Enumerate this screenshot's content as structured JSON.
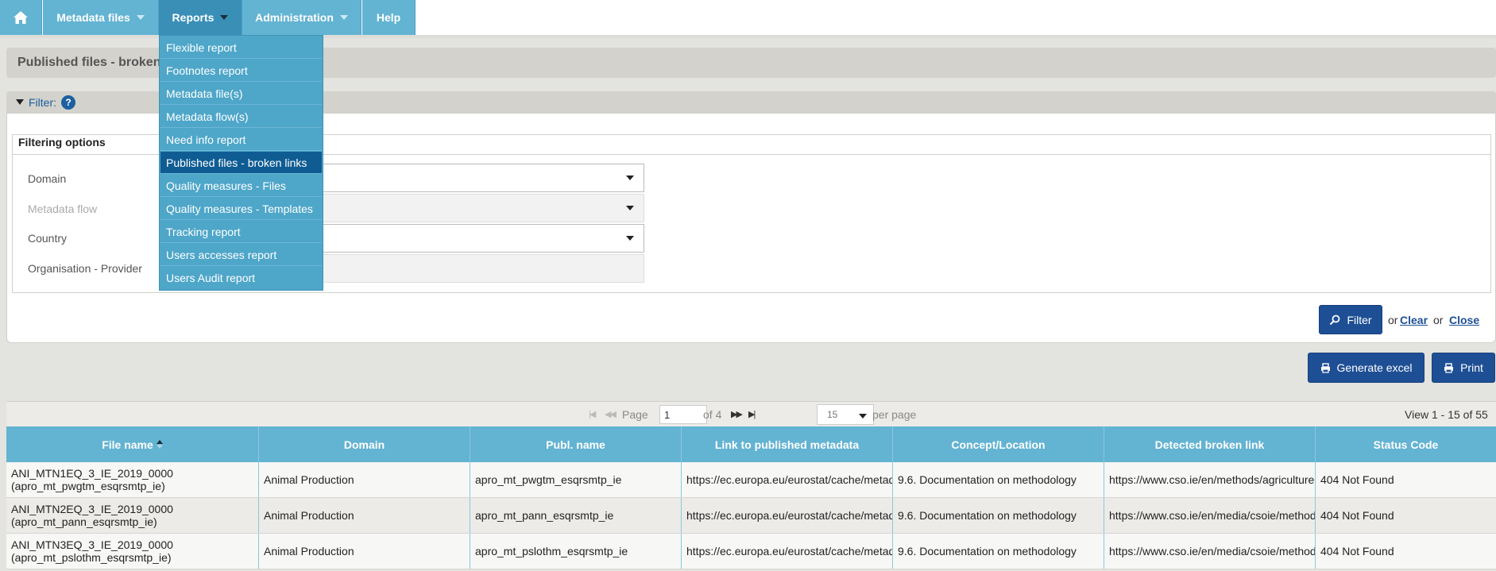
{
  "nav": {
    "items": [
      {
        "label": "Metadata files",
        "has_caret": true
      },
      {
        "label": "Reports",
        "has_caret": true,
        "active": true
      },
      {
        "label": "Administration",
        "has_caret": true
      },
      {
        "label": "Help",
        "has_caret": false
      }
    ]
  },
  "reports_menu": {
    "items": [
      "Flexible report",
      "Footnotes report",
      "Metadata file(s)",
      "Metadata flow(s)",
      "Need info report",
      "Published files - broken links",
      "Quality measures - Files",
      "Quality measures - Templates",
      "Tracking report",
      "Users accesses report",
      "Users Audit report"
    ],
    "active_item": "Published files - broken links"
  },
  "page": {
    "title": "Published files - broken links"
  },
  "filter": {
    "toggle_label": "Filter:",
    "help_label": "?",
    "legend": "Filtering options",
    "fields": [
      {
        "label": "Domain",
        "value": "",
        "disabled": false
      },
      {
        "label": "Metadata flow",
        "value": "",
        "disabled": true
      },
      {
        "label": "Country",
        "value": "",
        "disabled": false
      },
      {
        "label": "Organisation - Provider",
        "value": "",
        "disabled": true
      }
    ],
    "filter_button": "Filter",
    "or1": "or",
    "clear_link": "Clear",
    "or2": "or",
    "close_link": "Close"
  },
  "actions": {
    "generate_excel": "Generate excel",
    "print": "Print"
  },
  "pager": {
    "page_label": "Page",
    "page_value": "1",
    "of_label": "of 4",
    "per_page_value": "15",
    "per_page_label": "per page",
    "view_text": "View 1 - 15 of 55"
  },
  "table": {
    "columns": [
      "File name",
      "Domain",
      "Publ. name",
      "Link to published metadata",
      "Concept/Location",
      "Detected broken link",
      "Status Code"
    ],
    "sorted_column": "File name",
    "rows": [
      [
        "ANI_MTN1EQ_3_IE_2019_0000 (apro_mt_pwgtm_esqrsmtp_ie)",
        "Animal Production",
        "apro_mt_pwgtm_esqrsmtp_ie",
        "https://ec.europa.eu/eurostat/cache/metadata",
        "9.6. Documentation on methodology",
        "https://www.cso.ie/en/methods/agriculture",
        "404 Not Found"
      ],
      [
        "ANI_MTN2EQ_3_IE_2019_0000 (apro_mt_pann_esqrsmtp_ie)",
        "Animal Production",
        "apro_mt_pann_esqrsmtp_ie",
        "https://ec.europa.eu/eurostat/cache/metadata",
        "9.6. Documentation on methodology",
        "https://www.cso.ie/en/media/csoie/methods",
        "404 Not Found"
      ],
      [
        "ANI_MTN3EQ_3_IE_2019_0000 (apro_mt_pslothm_esqrsmtp_ie)",
        "Animal Production",
        "apro_mt_pslothm_esqrsmtp_ie",
        "https://ec.europa.eu/eurostat/cache/metadata",
        "9.6. Documentation on methodology",
        "https://www.cso.ie/en/media/csoie/methods",
        "404 Not Found"
      ]
    ]
  },
  "icons": {
    "home": "home-icon",
    "filter": "magnifier-icon",
    "excel": "printer-icon",
    "print": "printer-icon"
  },
  "colors": {
    "nav_bg": "#63b3d2",
    "nav_active": "#3a8fb7",
    "menu_active": "#0f5c93",
    "button": "#1e4f95"
  }
}
